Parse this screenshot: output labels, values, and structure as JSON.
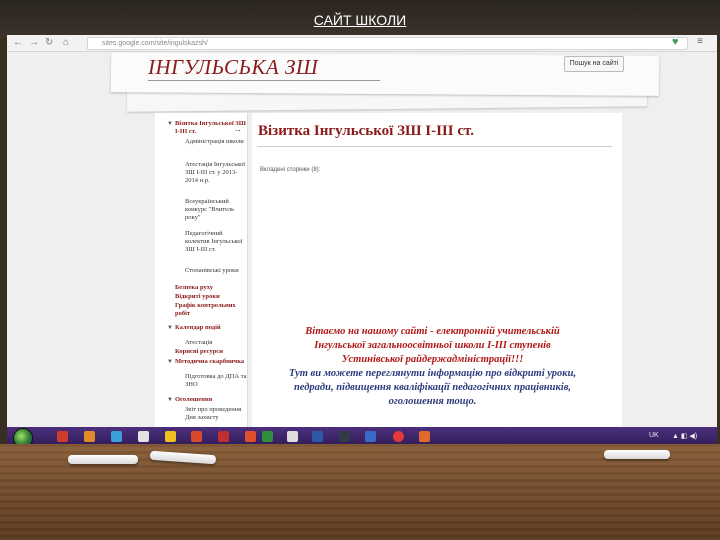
{
  "slide": {
    "title": "САЙТ ШКОЛИ"
  },
  "browser": {
    "url": "sites.google.com/site/ingulskazsh/"
  },
  "site": {
    "name": "ІНГУЛЬСЬКА ЗШ",
    "search_label": "Пошук на сайті",
    "page_title": "Візитка Інгульської ЗШ І-ІІІ ст.",
    "subpages_label": "Вкладені сторінки (8):",
    "welcome_lines": [
      "Вітаємо на нашому сайті - електронній учительській",
      "Інгульської загальноосвітньої школи І-ІІІ ступенів",
      "Устинівської райдержадміністрації!!!",
      "Тут ви можете переглянути інформацію про відкриті уроки,",
      "педради, підвищення кваліфікації педагогічних працівників,",
      "оголошення тощо."
    ]
  },
  "sidebar": {
    "items": [
      {
        "label": "Візитка Інгульської ЗШ І-ІІІ ст.",
        "level": 0,
        "toggle": "▼"
      },
      {
        "label": "Адміністрація школи",
        "level": 1
      },
      {
        "label": "Атестація Інгульської ЗШ І-ІІІ ст. у 2013-2014 н.р.",
        "level": 1
      },
      {
        "label": "Всеукраїнський конкурс \"Вчитель року\"",
        "level": 1
      },
      {
        "label": "Педагогічний колектив Інгульської ЗШ І-ІІІ ст.",
        "level": 1
      },
      {
        "label": "Стопанівські уроки",
        "level": 1
      },
      {
        "label": "Безпека руху",
        "level": 0
      },
      {
        "label": "Відкриті уроки",
        "level": 0
      },
      {
        "label": "Графік контрольних робіт",
        "level": 0
      },
      {
        "label": "Календар подій",
        "level": 0,
        "toggle": "▼"
      },
      {
        "label": "Атестація",
        "level": 1
      },
      {
        "label": "Корисні ресурси",
        "level": 0
      },
      {
        "label": "Методична скарбничка",
        "level": 0,
        "toggle": "▼"
      },
      {
        "label": "Підготовка до ДПА та ЗНО",
        "level": 1
      },
      {
        "label": "Оголошення",
        "level": 0,
        "toggle": "▼"
      },
      {
        "label": "Звіт про проведення Дня захисту",
        "level": 1
      }
    ]
  },
  "taskbar": {
    "tray_lang": "UK"
  },
  "colors": {
    "accent": "#8b1a1a",
    "taskbar": "#3b2266"
  }
}
